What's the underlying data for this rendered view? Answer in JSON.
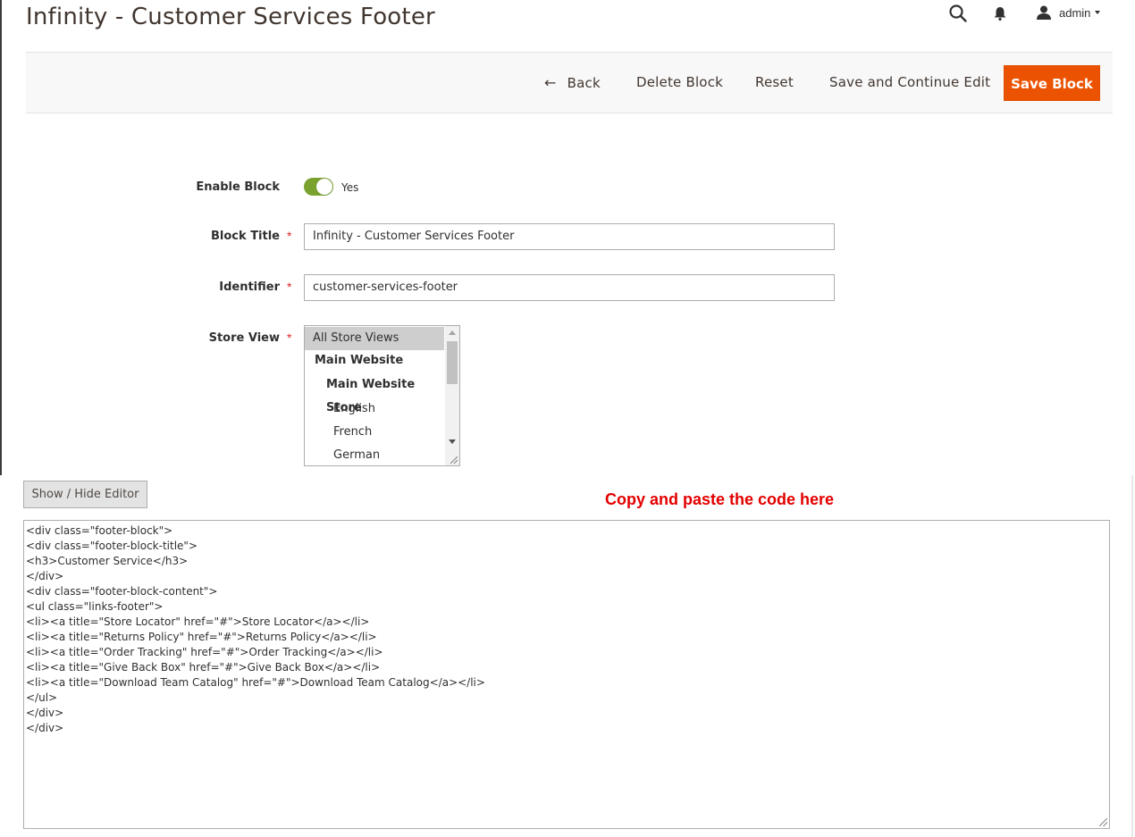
{
  "header": {
    "title": "Infinity - Customer Services Footer",
    "user_label": "admin",
    "icons": [
      "search-icon",
      "bell-icon",
      "user-icon",
      "caret-down-icon"
    ]
  },
  "actions": {
    "back_label": "Back",
    "delete_label": "Delete Block",
    "reset_label": "Reset",
    "save_continue_label": "Save and Continue Edit",
    "save_label": "Save Block",
    "accent_color": "#eb5202"
  },
  "form": {
    "enable_block": {
      "label": "Enable Block",
      "value_label": "Yes",
      "enabled": true
    },
    "block_title": {
      "label": "Block Title",
      "value": "Infinity - Customer Services Footer"
    },
    "identifier": {
      "label": "Identifier",
      "value": "customer-services-footer"
    },
    "store_view": {
      "label": "Store View",
      "options": [
        {
          "label": "All Store Views",
          "selected": true
        },
        {
          "label": "Main Website"
        },
        {
          "label": "Main Website Store"
        },
        {
          "label": "English"
        },
        {
          "label": "French"
        },
        {
          "label": "German"
        }
      ]
    },
    "required_mark": "*"
  },
  "editor": {
    "toggle_label": "Show / Hide Editor",
    "annotation": "Copy and paste the code here",
    "code_lines": [
      "<div class=\"footer-block\">",
      "<div class=\"footer-block-title\">",
      "<h3>Customer Service</h3>",
      "</div>",
      "<div class=\"footer-block-content\">",
      "<ul class=\"links-footer\">",
      "<li><a title=\"Store Locator\" href=\"#\">Store Locator</a></li>",
      "<li><a title=\"Returns Policy\" href=\"#\">Returns Policy</a></li>",
      "<li><a title=\"Order Tracking\" href=\"#\">Order Tracking</a></li>",
      "<li><a title=\"Give Back Box\" href=\"#\">Give Back Box</a></li>",
      "<li><a title=\"Download Team Catalog\" href=\"#\">Download Team Catalog</a></li>",
      "</ul>",
      "</div>",
      "</div>"
    ]
  }
}
